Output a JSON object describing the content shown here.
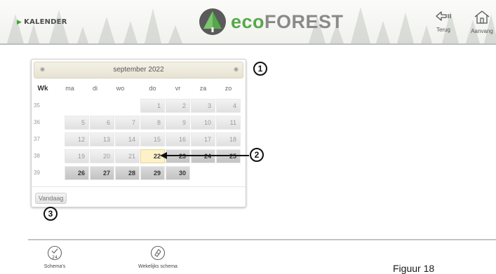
{
  "header": {
    "section_label": "KALENDER",
    "logo": {
      "part1": "eco",
      "part2": "FOREST",
      "brand_color": "#55a84a"
    },
    "nav": [
      {
        "label": "Terug",
        "icon": "back-icon"
      },
      {
        "label": "Aanvang",
        "icon": "home-icon"
      }
    ]
  },
  "calendar": {
    "month_title": "september 2022",
    "week_header": "Wk",
    "weekdays": [
      "ma",
      "di",
      "wo",
      "do",
      "vr",
      "za",
      "zo"
    ],
    "weeks": [
      {
        "week": "35",
        "days": [
          "",
          "",
          "",
          "1",
          "2",
          "3",
          "4"
        ]
      },
      {
        "week": "36",
        "days": [
          "5",
          "6",
          "7",
          "8",
          "9",
          "10",
          "11"
        ]
      },
      {
        "week": "37",
        "days": [
          "12",
          "13",
          "14",
          "15",
          "16",
          "17",
          "18"
        ]
      },
      {
        "week": "38",
        "days": [
          "19",
          "20",
          "21",
          "22",
          "23",
          "24",
          "25"
        ]
      },
      {
        "week": "39",
        "days": [
          "26",
          "27",
          "28",
          "29",
          "30",
          "",
          ""
        ]
      }
    ],
    "today_button": "Vandaag",
    "today_day": "22",
    "today_color": "#fdf1c8"
  },
  "annotations": [
    "1",
    "2",
    "3"
  ],
  "footer": {
    "buttons": [
      {
        "label": "Schema's",
        "icon_text": "24",
        "icon": "clock-24-icon"
      },
      {
        "label": "Wekelijks schema",
        "icon": "weekly-schedule-icon"
      }
    ],
    "cut_text": "Figuur 18"
  }
}
